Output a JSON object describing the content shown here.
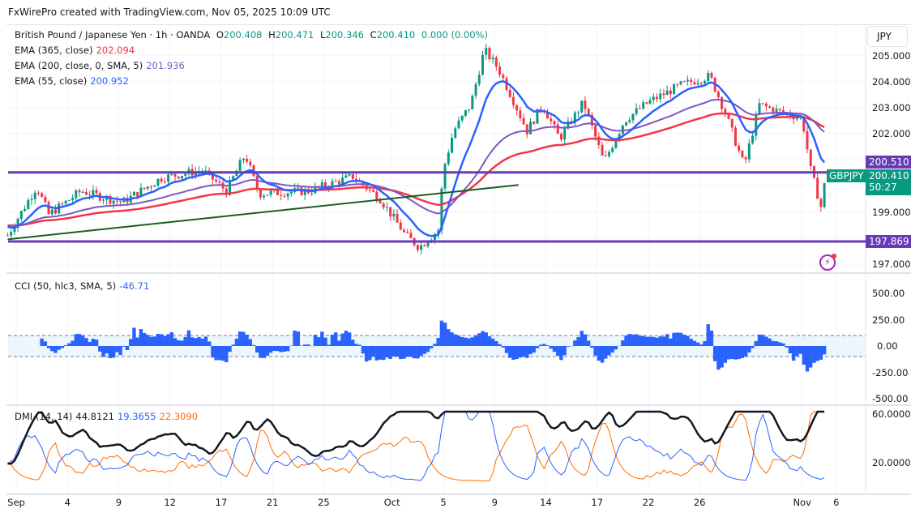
{
  "credit": "FxWirePro created with TradingView.com, Nov 05, 2025 10:09 UTC",
  "symbol": {
    "name": "British Pound / Japanese Yen · 1h · OANDA",
    "o_label": "O",
    "o": "200.408",
    "h_label": "H",
    "h": "200.471",
    "l_label": "L",
    "l": "200.346",
    "c_label": "C",
    "c": "200.410",
    "change": "0.000 (0.00%)"
  },
  "indicators": {
    "ema365": {
      "label": "EMA (365, close)",
      "value": "202.094",
      "color": "#f23645"
    },
    "ema200": {
      "label": "EMA (200, close, 0, SMA, 5)",
      "value": "201.936",
      "color": "#7e57c2"
    },
    "ema55": {
      "label": "EMA (55, close)",
      "value": "200.952",
      "color": "#2962ff"
    },
    "cci": {
      "label": "CCI (50, hlc3, SMA, 5)",
      "value": "-46.71",
      "color": "#2962ff"
    },
    "dmi": {
      "label": "DMI (14, 14)",
      "adx": "44.8121",
      "plus": "19.3655",
      "minus": "22.3090"
    }
  },
  "price_axis": {
    "currency": "JPY",
    "ticks": [
      "205.000",
      "204.000",
      "203.000",
      "202.000",
      "199.000",
      "197.000"
    ],
    "resistance_tag": "200.510",
    "price_tag": "200.410",
    "countdown": "50:27",
    "symbol_tag": "GBPJPY",
    "support_tag": "197.869"
  },
  "cci_axis": [
    "500.00",
    "250.00",
    "0.00",
    "-250.00",
    "-500.00"
  ],
  "dmi_axis": [
    "60.0000",
    "20.0000"
  ],
  "time_axis": [
    {
      "t": 0,
      "label": "Sep"
    },
    {
      "t": 3,
      "label": "4"
    },
    {
      "t": 6,
      "label": "9"
    },
    {
      "t": 9,
      "label": "12"
    },
    {
      "t": 12,
      "label": "17"
    },
    {
      "t": 15,
      "label": "21"
    },
    {
      "t": 18,
      "label": "25"
    },
    {
      "t": 22,
      "label": "Oct"
    },
    {
      "t": 25,
      "label": "5"
    },
    {
      "t": 28,
      "label": "9"
    },
    {
      "t": 31,
      "label": "14"
    },
    {
      "t": 34,
      "label": "17"
    },
    {
      "t": 37,
      "label": "22"
    },
    {
      "t": 40,
      "label": "26"
    },
    {
      "t": 46,
      "label": "Nov"
    },
    {
      "t": 48,
      "label": "6"
    }
  ],
  "chart_data": {
    "type": "candlestick",
    "title": "GBPJPY 1h",
    "price_keypoints": [
      [
        -0.5,
        198.1
      ],
      [
        1.2,
        199.98
      ],
      [
        1.9,
        198.9
      ],
      [
        3.8,
        199.8
      ],
      [
        6.2,
        199.36
      ],
      [
        8.5,
        200.3
      ],
      [
        10.9,
        200.6
      ],
      [
        12.3,
        199.8
      ],
      [
        13.4,
        201.2
      ],
      [
        14.2,
        199.7
      ],
      [
        17.1,
        199.8
      ],
      [
        19.7,
        200.35
      ],
      [
        21.3,
        199.5
      ],
      [
        22.8,
        198.1
      ],
      [
        23.6,
        197.65
      ],
      [
        24.7,
        198.3
      ],
      [
        25.0,
        200.6
      ],
      [
        25.6,
        202.1
      ],
      [
        26.6,
        203.1
      ],
      [
        27.4,
        205.2
      ],
      [
        28.2,
        204.5
      ],
      [
        29.0,
        203.4
      ],
      [
        29.9,
        202.1
      ],
      [
        30.8,
        203.1
      ],
      [
        31.8,
        201.8
      ],
      [
        33.2,
        203.2
      ],
      [
        34.4,
        200.9
      ],
      [
        35.6,
        202.5
      ],
      [
        37.0,
        203.2
      ],
      [
        38.9,
        203.85
      ],
      [
        40.6,
        204.2
      ],
      [
        41.5,
        202.8
      ],
      [
        42.6,
        200.75
      ],
      [
        43.5,
        203.1
      ],
      [
        44.8,
        202.8
      ],
      [
        46.0,
        202.6
      ],
      [
        46.5,
        200.6
      ],
      [
        47.1,
        199.2
      ],
      [
        47.4,
        200.41
      ]
    ],
    "horizontal_levels": [
      200.51,
      197.869
    ],
    "trendline": [
      [
        -0.5,
        197.95
      ],
      [
        29.4,
        200.03
      ]
    ],
    "ylim": [
      196.8,
      206.2
    ],
    "cci_ylim": [
      -560,
      560
    ],
    "dmi_ylim": [
      0,
      67
    ]
  }
}
